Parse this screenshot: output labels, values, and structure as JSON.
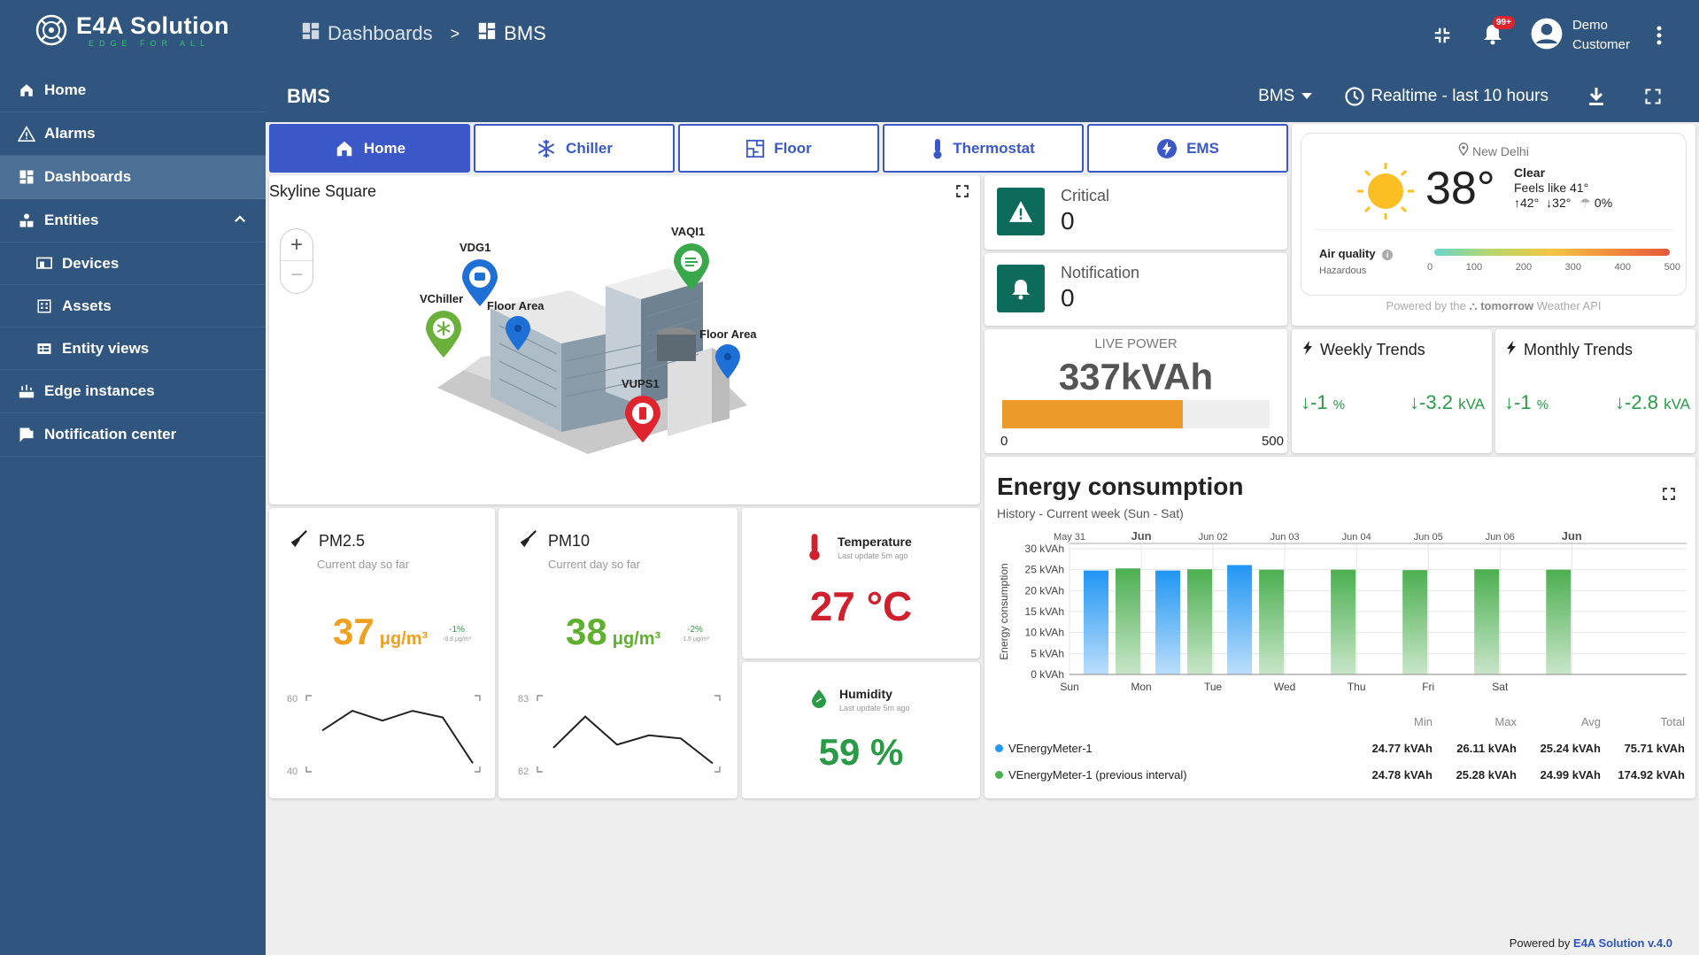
{
  "brand": {
    "title": "E4A Solution",
    "subtitle": "EDGE FOR ALL"
  },
  "sidebar": {
    "items": [
      {
        "label": "Home",
        "icon": "home-icon"
      },
      {
        "label": "Alarms",
        "icon": "warning-icon"
      },
      {
        "label": "Dashboards",
        "icon": "dashboard-icon"
      },
      {
        "label": "Entities",
        "icon": "entities-icon"
      },
      {
        "label": "Devices",
        "icon": "devices-icon"
      },
      {
        "label": "Assets",
        "icon": "assets-icon"
      },
      {
        "label": "Entity views",
        "icon": "entity-views-icon"
      },
      {
        "label": "Edge instances",
        "icon": "edge-icon"
      },
      {
        "label": "Notification center",
        "icon": "notification-icon"
      }
    ]
  },
  "topbar": {
    "breadcrumbs": [
      "Dashboards",
      "BMS"
    ],
    "separator": ">",
    "notif_badge": "99+",
    "user": {
      "line1": "Demo",
      "line2": "Customer"
    }
  },
  "dash": {
    "title": "BMS",
    "state_select": "BMS",
    "timewindow": "Realtime - last 10 hours"
  },
  "tabs": [
    {
      "label": "Home",
      "icon": "home-icon"
    },
    {
      "label": "Chiller",
      "icon": "snowflake-icon"
    },
    {
      "label": "Floor",
      "icon": "floor-plan-icon"
    },
    {
      "label": "Thermostat",
      "icon": "thermometer-icon"
    },
    {
      "label": "EMS",
      "icon": "bolt-icon"
    }
  ],
  "map": {
    "title": "Skyline Square",
    "pins": [
      {
        "label": "VDG1",
        "color": "#1e6fd6"
      },
      {
        "label": "VAQI1",
        "color": "#38a84a"
      },
      {
        "label": "VChiller",
        "color": "#6ab03b"
      },
      {
        "label": "Floor Area",
        "color": "#1e6fd6"
      },
      {
        "label": "Floor Area",
        "color": "#1e6fd6"
      },
      {
        "label": "VUPS1",
        "color": "#e0242f"
      }
    ]
  },
  "alarms": {
    "critical": {
      "title": "Critical",
      "value": "0"
    },
    "notification": {
      "title": "Notification",
      "value": "0"
    }
  },
  "weather": {
    "city": "New Delhi",
    "temp": "38°",
    "cond": "Clear",
    "feels": "Feels like 41°",
    "high": "42°",
    "low": "32°",
    "rain": "0%",
    "aq_label": "Air quality",
    "aq_status": "Hazardous",
    "aq_ticks": [
      "0",
      "100",
      "200",
      "300",
      "400",
      "500"
    ],
    "powered": "Powered by the",
    "provider": "tomorrow",
    "provider_suffix": "Weather API"
  },
  "live_power": {
    "title": "LIVE POWER",
    "value": "337kVAh",
    "min": "0",
    "max": "500",
    "level": 337
  },
  "weekly": {
    "title": "Weekly Trends",
    "pct": "-1",
    "pct_unit": "%",
    "kva": "-3.2",
    "kva_unit": "kVA"
  },
  "monthly": {
    "title": "Monthly Trends",
    "pct": "-1",
    "pct_unit": "%",
    "kva": "-2.8",
    "kva_unit": "kVA"
  },
  "pm25": {
    "title": "PM2.5",
    "sub": "Current day so far",
    "value": "37",
    "unit": "μg/m³",
    "delta": "-1%",
    "delta_sub": "-0.8 μg/m³",
    "ymax": "60",
    "ymin": "40",
    "spark": [
      51,
      57,
      54,
      57,
      55,
      41
    ]
  },
  "pm10": {
    "title": "PM10",
    "sub": "Current day so far",
    "value": "38",
    "unit": "μg/m³",
    "delta": "-2%",
    "delta_sub": "-1.6 μg/m³",
    "ymax": "83",
    "ymin": "62",
    "spark": [
      68,
      78,
      69,
      72,
      71,
      63
    ]
  },
  "temperature": {
    "title": "Temperature",
    "sub": "Last update 5m ago",
    "value": "27 °C"
  },
  "humidity": {
    "title": "Humidity",
    "sub": "Last update 5m ago",
    "value": "59 %"
  },
  "energy": {
    "title": "Energy consumption",
    "sub": "History - Current week (Sun - Sat)",
    "legend_headers": [
      "Min",
      "Max",
      "Avg",
      "Total"
    ],
    "legend": [
      {
        "name": "VEnergyMeter-1",
        "color": "#2196f3",
        "min": "24.77 kVAh",
        "max": "26.11 kVAh",
        "avg": "25.24 kVAh",
        "total": "75.71 kVAh"
      },
      {
        "name": "VEnergyMeter-1 (previous interval)",
        "color": "#4caf50",
        "min": "24.78 kVAh",
        "max": "25.28 kVAh",
        "avg": "24.99 kVAh",
        "total": "174.92 kVAh"
      }
    ]
  },
  "footer": {
    "prefix": "Powered by",
    "brand": "E4A Solution v.4.0"
  },
  "chart_data": {
    "type": "bar",
    "title": "Energy consumption",
    "ylabel": "Energy consumption",
    "categories": [
      "Sun",
      "Mon",
      "Tue",
      "Wed",
      "Thu",
      "Fri",
      "Sat"
    ],
    "top_ticks": [
      "May 31",
      "Jun",
      "Jun 02",
      "Jun 03",
      "Jun 04",
      "Jun 05",
      "Jun 06",
      "Jun"
    ],
    "y_ticks": [
      "0 kVAh",
      "5 kVAh",
      "10 kVAh",
      "15 kVAh",
      "20 kVAh",
      "25 kVAh",
      "30 kVAh"
    ],
    "ylim": [
      0,
      30
    ],
    "series": [
      {
        "name": "VEnergyMeter-1",
        "values": [
          24.8,
          24.8,
          26.1,
          null,
          null,
          null,
          null
        ]
      },
      {
        "name": "VEnergyMeter-1 (previous interval)",
        "values": [
          25.3,
          25.1,
          25.0,
          25.0,
          24.9,
          25.1,
          25.0
        ]
      }
    ]
  }
}
